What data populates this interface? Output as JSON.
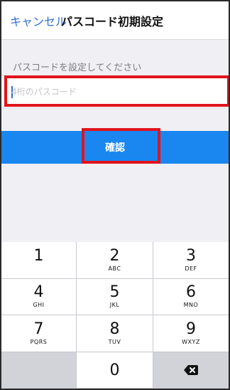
{
  "nav": {
    "cancel_label": "キャンセル",
    "title": "パスコード初期設定"
  },
  "form": {
    "prompt": "パスコードを設定してください",
    "passcode_placeholder": "4桁のパスコード",
    "passcode_value": "",
    "confirm_label": "確認"
  },
  "keypad": {
    "keys": [
      {
        "digit": "1",
        "letters": ""
      },
      {
        "digit": "2",
        "letters": "ABC"
      },
      {
        "digit": "3",
        "letters": "DEF"
      },
      {
        "digit": "4",
        "letters": "GHI"
      },
      {
        "digit": "5",
        "letters": "JKL"
      },
      {
        "digit": "6",
        "letters": "MNO"
      },
      {
        "digit": "7",
        "letters": "PQRS"
      },
      {
        "digit": "8",
        "letters": "TUV"
      },
      {
        "digit": "9",
        "letters": "WXYZ"
      },
      {
        "digit": "0",
        "letters": ""
      }
    ],
    "delete_icon": "backspace-icon"
  },
  "colors": {
    "accent": "#2f6fd6",
    "confirm_bar": "#1a86f0",
    "highlight": "#e0141b",
    "background": "#efeff4"
  }
}
